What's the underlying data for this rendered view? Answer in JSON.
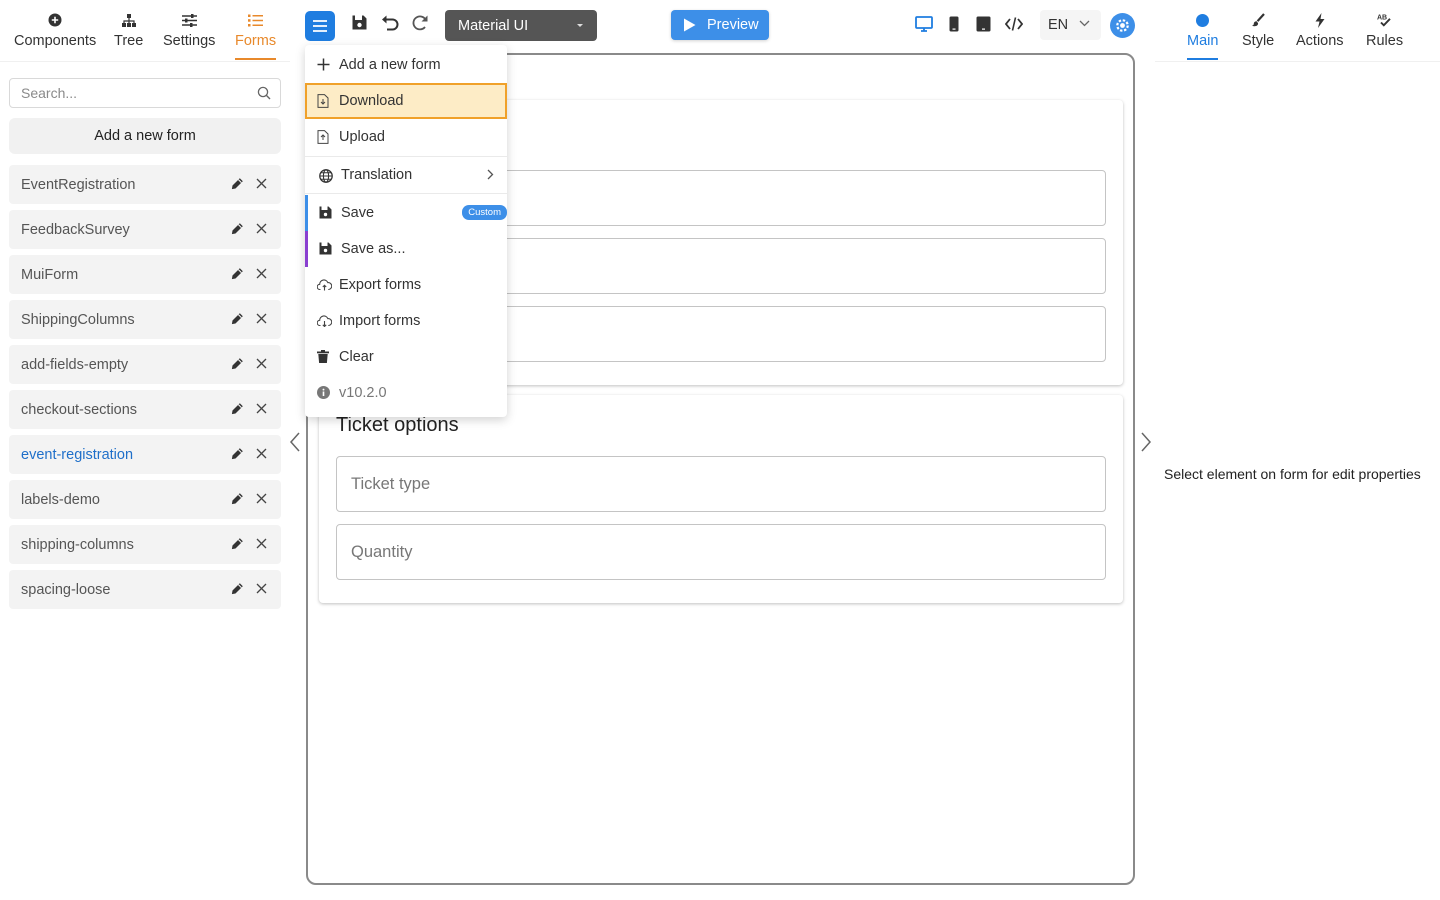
{
  "left_tabs": [
    {
      "label": "Components",
      "icon": "plus-circle-icon"
    },
    {
      "label": "Tree",
      "icon": "tree-icon"
    },
    {
      "label": "Settings",
      "icon": "sliders-icon"
    },
    {
      "label": "Forms",
      "icon": "list-icon",
      "active": true
    }
  ],
  "search": {
    "placeholder": "Search..."
  },
  "add_form_label": "Add a new form",
  "forms": [
    "EventRegistration",
    "FeedbackSurvey",
    "MuiForm",
    "ShippingColumns",
    "add-fields-empty",
    "checkout-sections",
    "event-registration",
    "labels-demo",
    "shipping-columns",
    "spacing-loose"
  ],
  "current_form": "event-registration",
  "toolbar": {
    "theme": "Material UI",
    "preview_label": "Preview",
    "language": "EN"
  },
  "menu": {
    "add": "Add a new form",
    "download": "Download",
    "upload": "Upload",
    "translation": "Translation",
    "save": "Save",
    "save_badge": "Custom",
    "save_as": "Save as...",
    "export": "Export forms",
    "import": "Import forms",
    "clear": "Clear",
    "version": "v10.2.0"
  },
  "canvas": {
    "section2_title": "Ticket options",
    "fields": [
      "Ticket type",
      "Quantity"
    ]
  },
  "right_tabs": [
    {
      "label": "Main",
      "icon": "dot-icon",
      "active": true
    },
    {
      "label": "Style",
      "icon": "brush-icon"
    },
    {
      "label": "Actions",
      "icon": "bolt-icon"
    },
    {
      "label": "Rules",
      "icon": "rules-icon"
    }
  ],
  "props_hint": "Select element on form for edit properties",
  "colors": {
    "accent_orange": "#e8892b",
    "accent_blue": "#1f7de0",
    "highlight_bg": "#fdecc6",
    "highlight_border": "#f0a12a",
    "theme_select_bg": "#555555"
  }
}
